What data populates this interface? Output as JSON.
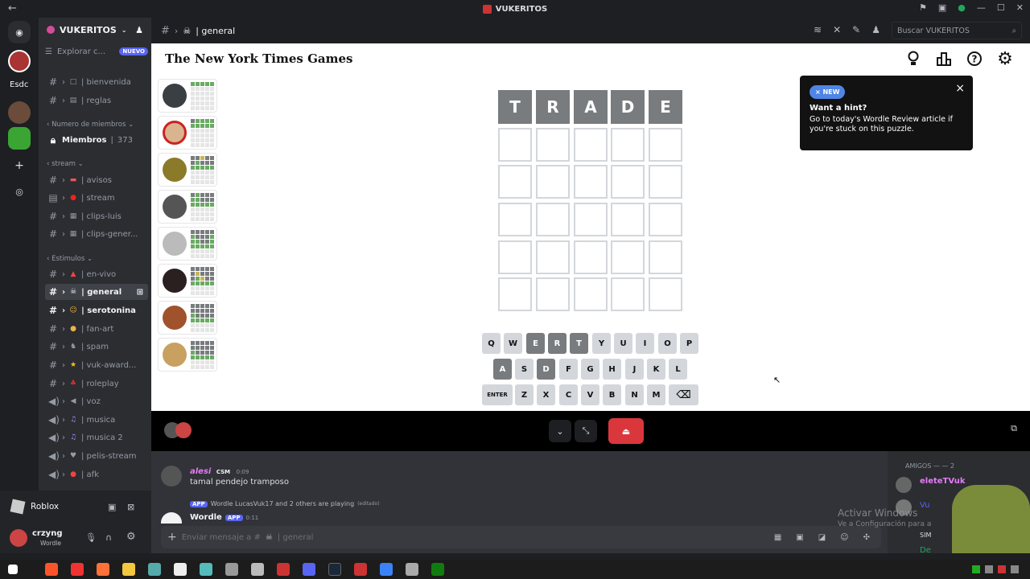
{
  "window": {
    "title": "VUKERITOS"
  },
  "rail": {
    "server_label": "Esdc"
  },
  "server": {
    "name": "VUKERITOS",
    "explore_label": "Explorar c...",
    "explore_badge": "NUEVO",
    "categories": {
      "members": "Numero de miembros",
      "stream": "stream",
      "stimulus": "Estimulos"
    },
    "members_channel": {
      "label": "Miembros",
      "count": "373"
    },
    "channels": [
      {
        "label": "| bienvenida",
        "icon": "□"
      },
      {
        "label": "| reglas",
        "icon": "▤"
      },
      {
        "label": "| avisos",
        "icon": "▬"
      },
      {
        "label": "| stream",
        "icon": "●"
      },
      {
        "label": "| clips-luis",
        "icon": "▦"
      },
      {
        "label": "| clips-gener...",
        "icon": "▦"
      },
      {
        "label": "| en-vivo",
        "icon": "▲"
      },
      {
        "label": "| general",
        "icon": "☠"
      },
      {
        "label": "| serotonina",
        "icon": "☺"
      },
      {
        "label": "| fan-art",
        "icon": "●"
      },
      {
        "label": "| spam",
        "icon": "♞"
      },
      {
        "label": "| vuk-award...",
        "icon": "★"
      },
      {
        "label": "| roleplay",
        "icon": "♣"
      },
      {
        "label": "| voz",
        "icon": "◀"
      },
      {
        "label": "| musica",
        "icon": "♫"
      },
      {
        "label": "| musica 2",
        "icon": "♫"
      },
      {
        "label": "| pelis-stream",
        "icon": "♥"
      },
      {
        "label": "| afk",
        "icon": "●"
      }
    ]
  },
  "activity": {
    "label": "Roblox"
  },
  "user": {
    "name": "crzyng",
    "status": "Wordle"
  },
  "header": {
    "channel": "| general",
    "search_placeholder": "Buscar VUKERITOS"
  },
  "game": {
    "brand": "The New York Times Games",
    "hint": {
      "badge": "× NEW",
      "title": "Want a hint?",
      "body": "Go to today's Wordle Review article if you're stuck on this puzzle.",
      "close": "×"
    },
    "board_row1": [
      "T",
      "R",
      "A",
      "D",
      "E"
    ],
    "keyboard": {
      "row1": [
        "Q",
        "W",
        "E",
        "R",
        "T",
        "Y",
        "U",
        "I",
        "O",
        "P"
      ],
      "row2": [
        "A",
        "S",
        "D",
        "F",
        "G",
        "H",
        "J",
        "K",
        "L"
      ],
      "row3": [
        "ENTER",
        "Z",
        "X",
        "C",
        "V",
        "B",
        "N",
        "M",
        "⌫"
      ]
    }
  },
  "chat": {
    "msg1_author": "alesi",
    "msg1_tag": "CSM",
    "msg1_time": "0:09",
    "msg1_text": "tamal pendejo tramposo",
    "activity_app": "APP",
    "activity_text": "Wordle LucasVuk17 and 2 others are playing",
    "activity_edited": "(editado)",
    "msg2_author": "Wordle",
    "msg2_app": "APP",
    "msg2_time": "0:11",
    "input_placeholder": "Enviar mensaje a #",
    "input_channel": "| general"
  },
  "members_panel": {
    "header": "AMIGOS — — 2",
    "member1": "eleteTVuk",
    "member2": "Vu",
    "member3": "SIM",
    "member4": "De",
    "watermark_title": "Activar Windows",
    "watermark_sub": "Ve a Configuración para a"
  }
}
